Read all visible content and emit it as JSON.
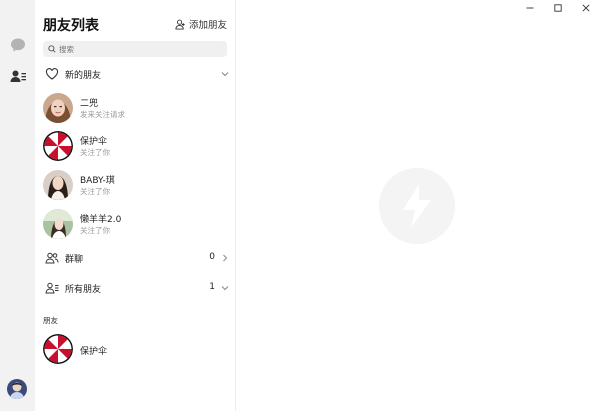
{
  "panel": {
    "title": "朋友列表",
    "add_friend_label": "添加朋友",
    "search_placeholder": "搜索"
  },
  "sections": {
    "new_friends": {
      "label": "新的朋友"
    },
    "groups": {
      "label": "群聊",
      "count": "0"
    },
    "all_friends": {
      "label": "所有朋友",
      "count": "1"
    }
  },
  "new_friend_requests": [
    {
      "name": "二兜",
      "status": "发来关注请求",
      "avatar": "photo-girl-1"
    },
    {
      "name": "保护伞",
      "status": "关注了你",
      "avatar": "umbrella-logo"
    },
    {
      "name": "BABY-琪",
      "status": "关注了你",
      "avatar": "photo-girl-2"
    },
    {
      "name": "懒羊羊2.0",
      "status": "关注了你",
      "avatar": "photo-girl-3"
    }
  ],
  "friends_heading": "朋友",
  "friends": [
    {
      "name": "保护伞",
      "avatar": "umbrella-logo"
    }
  ],
  "colors": {
    "rail_bg": "#f2f2f2",
    "umbrella_red": "#c8102e",
    "muted_text": "#999999"
  }
}
